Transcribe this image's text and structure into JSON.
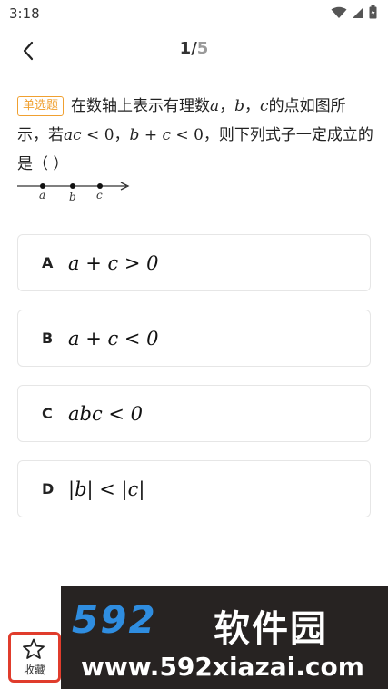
{
  "status_bar": {
    "time": "3:18"
  },
  "nav": {
    "current": "1",
    "separator": "/",
    "total": "5"
  },
  "question": {
    "type_label": "单选题",
    "text_1": "在数轴上表示有理数",
    "var_a": "a",
    "sep_1": "，",
    "var_b": "b",
    "sep_2": "，",
    "var_c": "c",
    "text_2": "的点如图所示，若",
    "cond_1": "ac",
    "cond_1_op": " < 0",
    "sep_3": "，",
    "cond_2_b": "b",
    "cond_2_plus": " + ",
    "cond_2_c": "c",
    "cond_2_op": " < 0",
    "text_3": "，则下列式子一定成立的是（ ）",
    "number_line": {
      "labels": [
        "a",
        "b",
        "c"
      ]
    }
  },
  "options": [
    {
      "letter": "A",
      "text": "a + c > 0"
    },
    {
      "letter": "B",
      "text": "a + c < 0"
    },
    {
      "letter": "C",
      "text": "abc < 0"
    },
    {
      "letter": "D",
      "text": "|b| < |c|"
    }
  ],
  "bottom_bar": {
    "favorite_label": "收藏"
  },
  "watermark": {
    "logo": "592",
    "name": "软件园",
    "url": "www.592xiazai.com"
  }
}
